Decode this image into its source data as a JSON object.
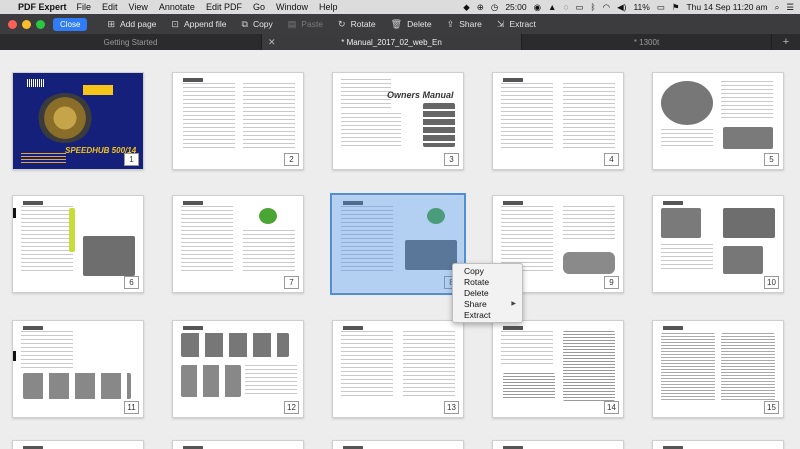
{
  "menubar": {
    "app_name": "PDF Expert",
    "menus": [
      "File",
      "Edit",
      "View",
      "Annotate",
      "Edit PDF",
      "Go",
      "Window",
      "Help"
    ],
    "status": {
      "time_remaining": "25:00",
      "battery": "11%",
      "datetime": "Thu 14 Sep  11:20 am"
    }
  },
  "toolbar": {
    "close_label": "Close",
    "add_page": "Add page",
    "append_file": "Append file",
    "copy": "Copy",
    "paste": "Paste",
    "rotate": "Rotate",
    "delete": "Delete",
    "share": "Share",
    "extract": "Extract"
  },
  "tabs": [
    {
      "label": "Getting Started",
      "active": false
    },
    {
      "label": "* Manual_2017_02_web_En",
      "active": true
    },
    {
      "label": "* 1300t",
      "active": false
    }
  ],
  "pages": [
    "1",
    "2",
    "3",
    "4",
    "5",
    "6",
    "7",
    "8",
    "9",
    "10",
    "11",
    "12",
    "13",
    "14",
    "15"
  ],
  "page_titles": {
    "cover_title": "SPEEDHUB 500/14",
    "owners_manual": "Owners Manual"
  },
  "selected_page": "8",
  "context_menu": {
    "items": [
      "Copy",
      "Rotate",
      "Delete",
      "Share",
      "Extract"
    ]
  },
  "colors": {
    "accent": "#2f7cf6",
    "selection": "#4a90e2",
    "cover": "#15207a"
  }
}
